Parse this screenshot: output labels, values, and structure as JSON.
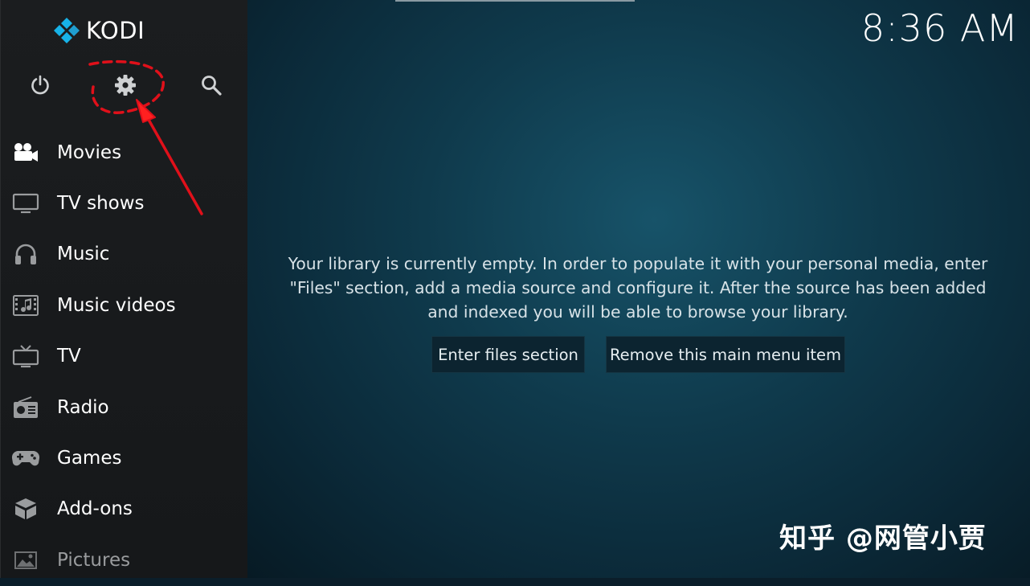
{
  "app": {
    "name": "KODI"
  },
  "clock": {
    "time": "8:36 AM"
  },
  "top_icons": [
    {
      "icon": "power-icon"
    },
    {
      "icon": "gear-icon"
    },
    {
      "icon": "search-icon"
    }
  ],
  "nav": {
    "items": [
      {
        "label": "Movies",
        "icon": "movie-camera-icon"
      },
      {
        "label": "TV shows",
        "icon": "monitor-icon"
      },
      {
        "label": "Music",
        "icon": "headphones-icon"
      },
      {
        "label": "Music videos",
        "icon": "music-video-icon"
      },
      {
        "label": "TV",
        "icon": "tv-icon"
      },
      {
        "label": "Radio",
        "icon": "radio-icon"
      },
      {
        "label": "Games",
        "icon": "gamepad-icon"
      },
      {
        "label": "Add-ons",
        "icon": "addons-box-icon"
      },
      {
        "label": "Pictures",
        "icon": "pictures-icon"
      }
    ]
  },
  "main": {
    "message_lines": [
      "Your library is currently empty. In order to populate it with your personal media, enter",
      "\"Files\" section, add a media source and configure it. After the source has been added",
      "and indexed you will be able to browse your library."
    ],
    "buttons": {
      "enter_files": "Enter files section",
      "remove_item": "Remove this main menu item"
    }
  },
  "watermark": {
    "text": "知乎 @网管小贾"
  },
  "colors": {
    "accent_annotation": "#e0101a",
    "logo_blue": "#17b2e7",
    "sidebar_bg": "#1b1d1f",
    "main_bg": "#0f3a4c"
  }
}
